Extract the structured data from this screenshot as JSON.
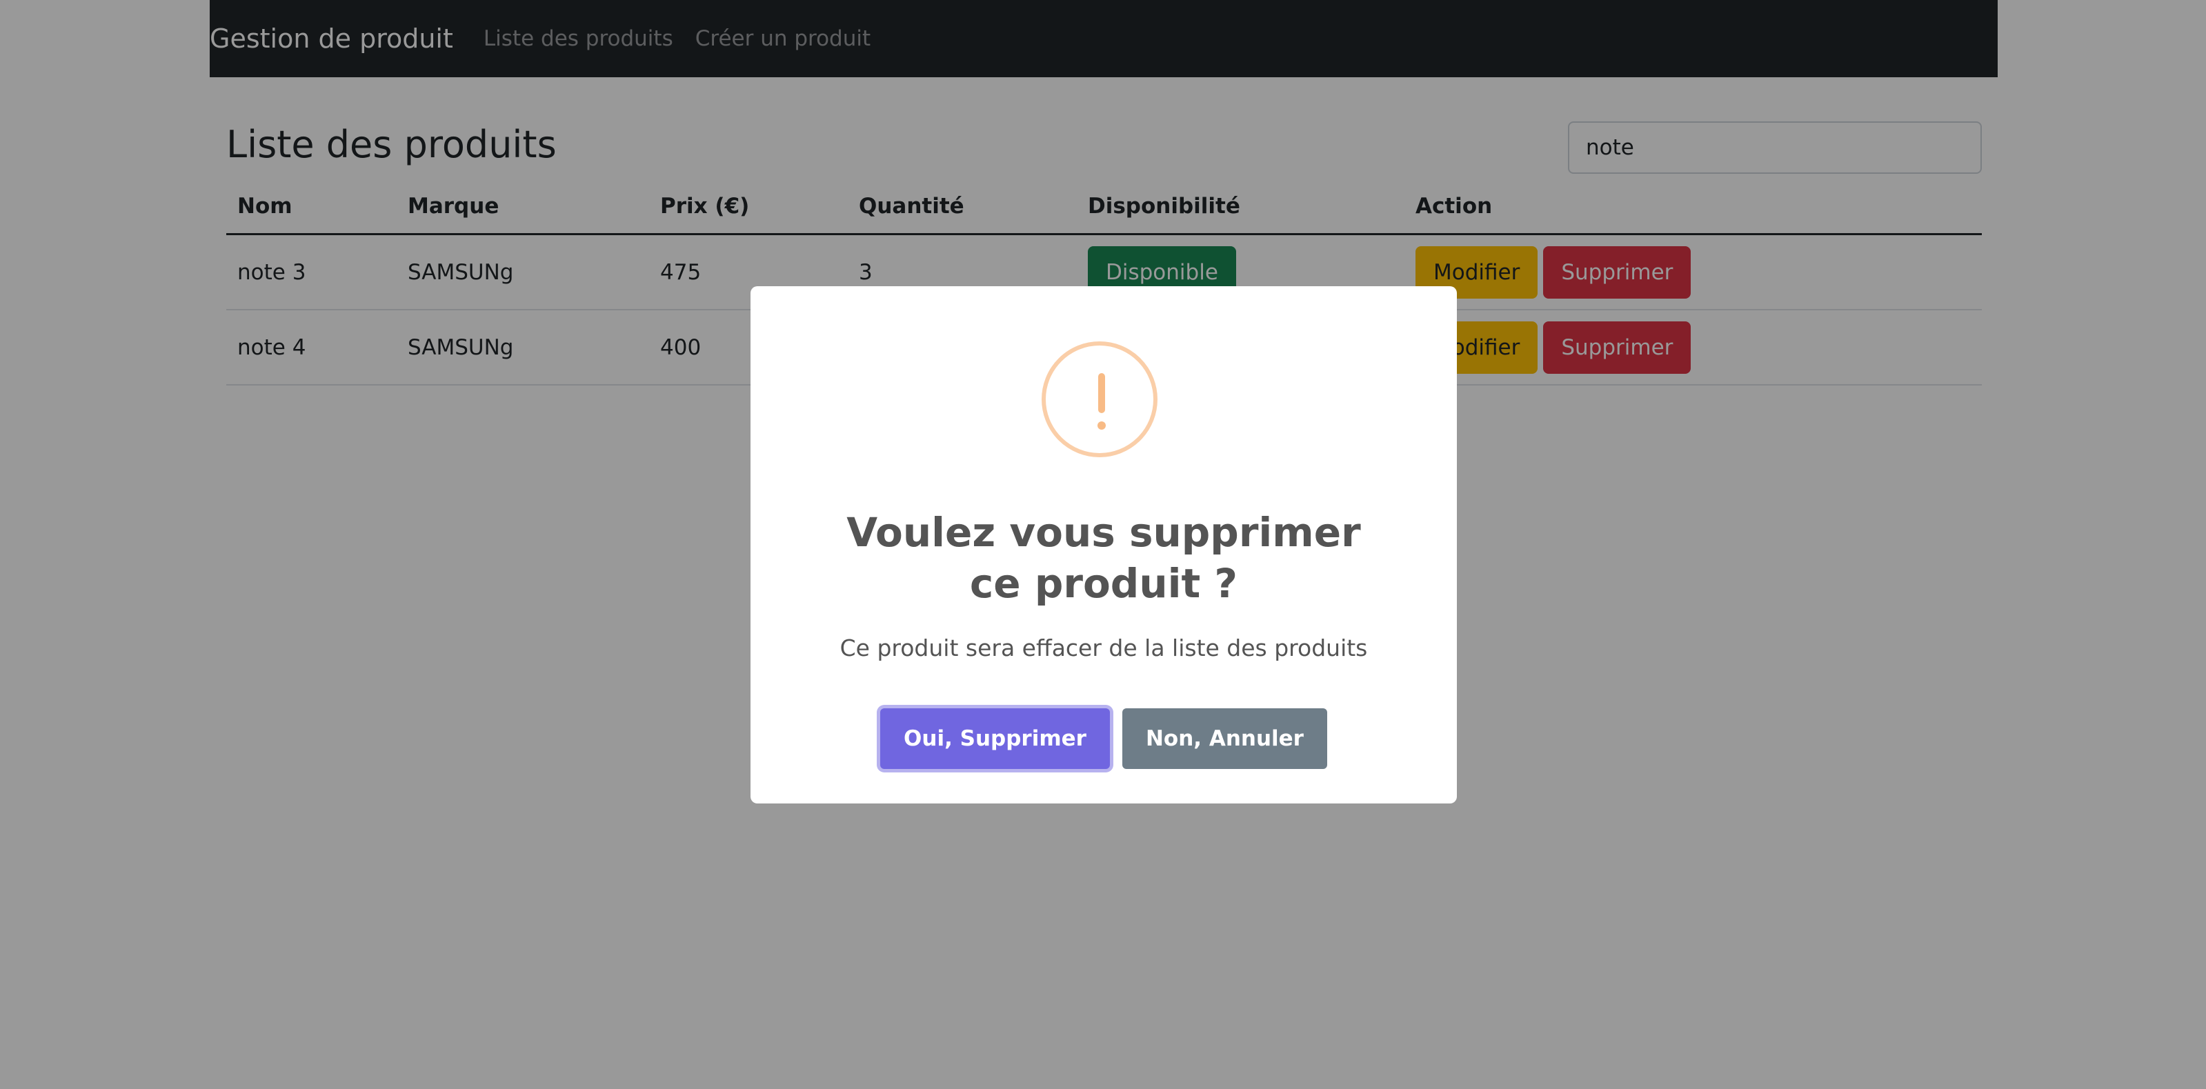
{
  "navbar": {
    "brand": "Gestion de produit",
    "links": [
      "Liste des produits",
      "Créer un produit"
    ]
  },
  "page": {
    "title": "Liste des produits",
    "search_value": "note"
  },
  "table": {
    "headers": [
      "Nom",
      "Marque",
      "Prix (€)",
      "Quantité",
      "Disponibilité",
      "Action"
    ],
    "rows": [
      {
        "nom": "note 3",
        "marque": "SAMSUNg",
        "prix": "475",
        "quantite": "3",
        "disponibilite": "Disponible"
      },
      {
        "nom": "note 4",
        "marque": "SAMSUNg",
        "prix": "400",
        "quantite": "",
        "disponibilite": ""
      }
    ],
    "edit_label": "Modifier",
    "delete_label": "Supprimer"
  },
  "modal": {
    "icon": "exclamation-icon",
    "title": "Voulez vous supprimer ce produit ?",
    "text": "Ce produit sera effacer de la liste des produits",
    "confirm_label": "Oui, Supprimer",
    "cancel_label": "Non, Annuler"
  },
  "colors": {
    "navbar_bg": "#212529",
    "success": "#198754",
    "warning": "#ffc107",
    "danger": "#dc3545",
    "confirm": "#7066e0",
    "cancel": "#6e7d88",
    "warning_icon": "#f8bb86"
  }
}
